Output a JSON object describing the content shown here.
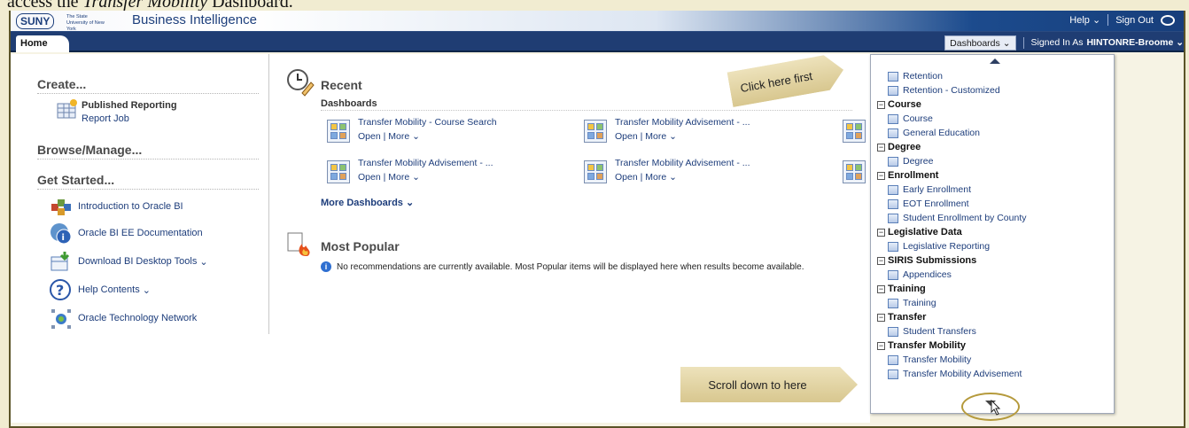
{
  "header": {
    "caption": "access the Transfer Mobility Dashboard.",
    "caption_prefix": "access the ",
    "caption_italic": "Transfer Mobility",
    "caption_suffix": " Dashboard.",
    "logo_text": "SUNY",
    "logo_sub": "The State University of New York",
    "app_title": "Business Intelligence",
    "help": "Help",
    "sign_out": "Sign Out"
  },
  "tabs": {
    "home": "Home",
    "dashboards": "Dashboards",
    "signed_in_label": "Signed In As",
    "user": "HINTONRE-Broome"
  },
  "left": {
    "create": "Create...",
    "published_reporting": "Published Reporting",
    "report_job": "Report Job",
    "browse": "Browse/Manage...",
    "get_started": "Get Started...",
    "links": [
      "Introduction to Oracle BI",
      "Oracle BI EE Documentation",
      "Download BI Desktop Tools",
      "Help Contents",
      "Oracle Technology Network"
    ]
  },
  "recent": {
    "title": "Recent",
    "subtitle": "Dashboards",
    "items": [
      {
        "name": "Transfer Mobility - Course Search",
        "links": "Open | More"
      },
      {
        "name": "Transfer Mobility Advisement - ...",
        "links": "Open | More"
      },
      {
        "name": "Transfer Mobility Advisement - ...",
        "links": "Open | More"
      },
      {
        "name": "Transfer Mobility Advisement - ...",
        "links": "Open | More"
      }
    ],
    "more": "More Dashboards"
  },
  "popular": {
    "title": "Most Popular",
    "message": "No recommendations are currently available. Most Popular items will be displayed here when results become available."
  },
  "dropdown": {
    "top_items": [
      "Retention",
      "Retention - Customized"
    ],
    "groups": [
      {
        "name": "Course",
        "items": [
          "Course",
          "General Education"
        ]
      },
      {
        "name": "Degree",
        "items": [
          "Degree"
        ]
      },
      {
        "name": "Enrollment",
        "items": [
          "Early Enrollment",
          "EOT Enrollment",
          "Student Enrollment by County"
        ]
      },
      {
        "name": "Legislative Data",
        "items": [
          "Legislative Reporting"
        ]
      },
      {
        "name": "SIRIS Submissions",
        "items": [
          "Appendices"
        ]
      },
      {
        "name": "Training",
        "items": [
          "Training"
        ]
      },
      {
        "name": "Transfer",
        "items": [
          "Student Transfers"
        ]
      },
      {
        "name": "Transfer Mobility",
        "items": [
          "Transfer Mobility",
          "Transfer Mobility Advisement"
        ]
      }
    ]
  },
  "callouts": {
    "first": "Click here first",
    "scroll": "Scroll down to here"
  }
}
